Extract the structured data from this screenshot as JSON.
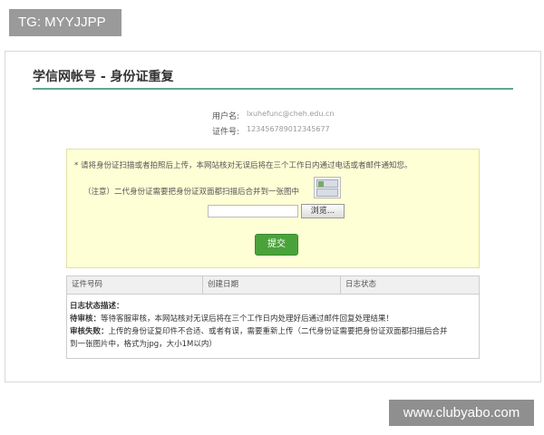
{
  "watermarks": {
    "top_left": "TG: MYYJJPP",
    "bottom_right": "www.clubyabo.com"
  },
  "page": {
    "title": "学信网帐号 - 身份证重复"
  },
  "account": {
    "username_label": "用户名:",
    "username_value": "lxuhefunc@cheh.edu.cn",
    "id_label": "证件号:",
    "id_value": "123456789012345677"
  },
  "upload": {
    "notice": "* 请将身份证扫描或者拍照后上传，本网站核对无误后将在三个工作日内通过电话或者邮件通知您。",
    "note": "（注意）二代身份证需要把身份证双面都扫描后合并到一张图中",
    "file_value": "",
    "browse_label": "浏览...",
    "submit_label": "提交"
  },
  "log_table": {
    "columns": [
      "证件号码",
      "创建日期",
      "日志状态"
    ],
    "legend_title": "日志状态描述：",
    "pending_term": "待审核：",
    "pending_desc": "等待客服审核，本网站核对无误后将在三个工作日内处理好后通过邮件回复处理结果！",
    "failed_term": "审核失败：",
    "failed_desc_1": "上传的身份证复印件不合适、或者有误，需要重新上传（二代身份证需要把身份证双面都扫描后合并",
    "failed_desc_2": "到一张图片中，格式为jpg，大小1M以内）"
  }
}
